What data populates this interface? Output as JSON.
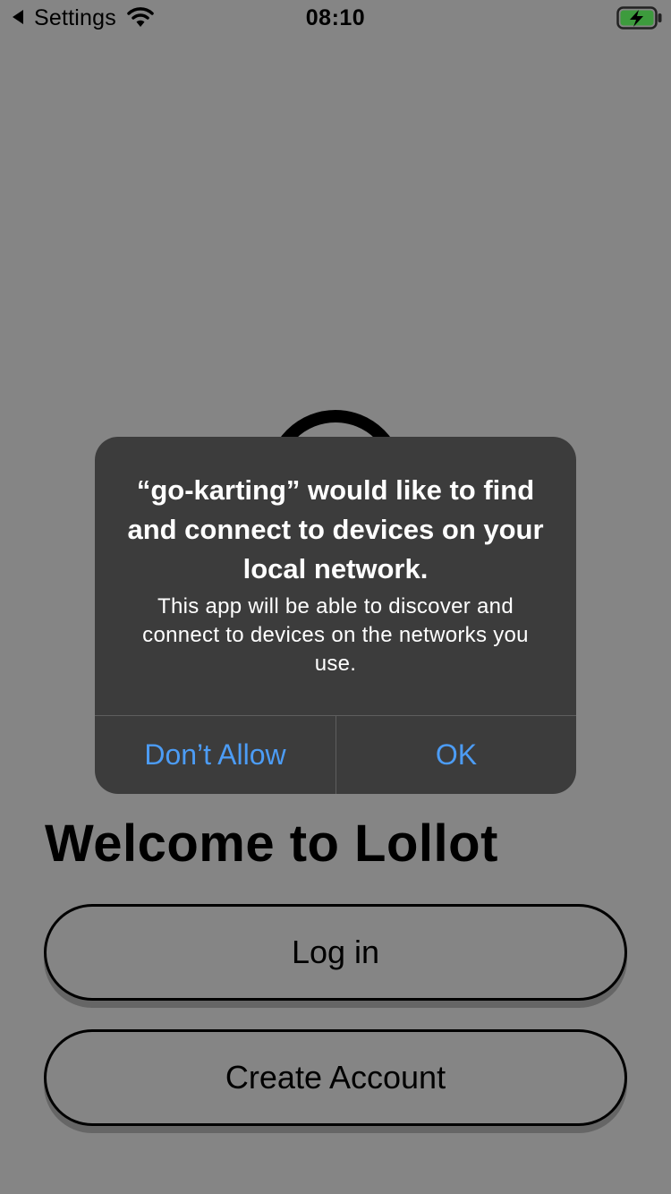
{
  "status_bar": {
    "back_label": "Settings",
    "time": "08:10"
  },
  "alert": {
    "title": "“go-karting” would like to find and connect to devices on your local network.",
    "message": "This app will be able to discover and connect to devices on the networks you use.",
    "dont_allow_label": "Don’t Allow",
    "ok_label": "OK",
    "accent_color": "#4c9cf5"
  },
  "main": {
    "welcome_title": "Welcome to Lollot",
    "login_label": "Log in",
    "create_account_label": "Create Account"
  }
}
